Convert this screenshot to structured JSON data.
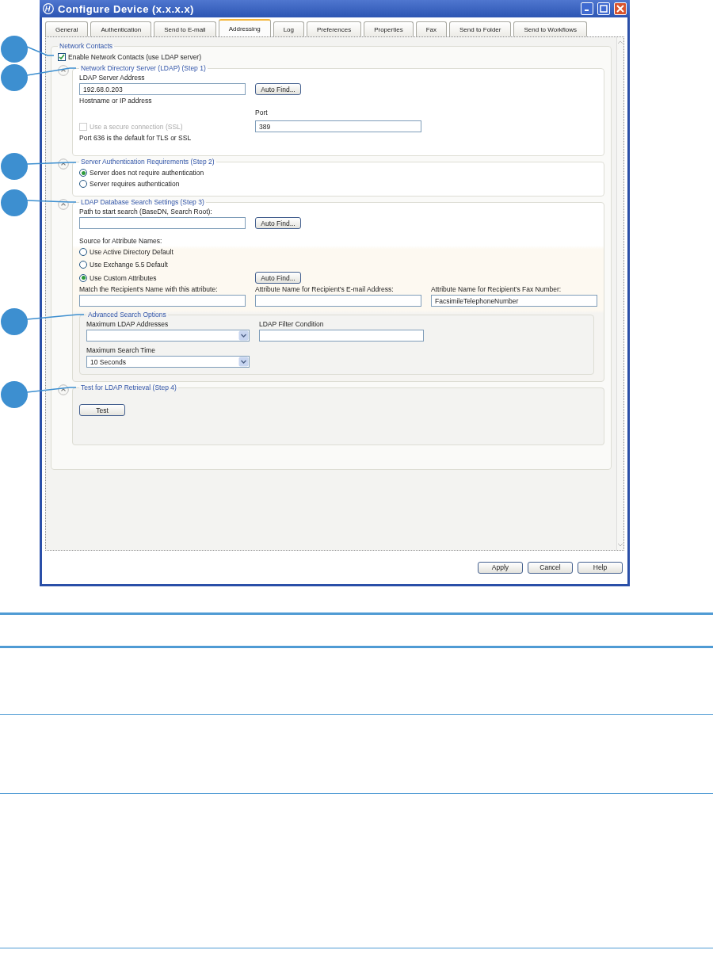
{
  "window": {
    "title": "Configure Device (x.x.x.x)",
    "buttons": [
      "Apply",
      "Cancel",
      "Help"
    ]
  },
  "tabs": [
    {
      "label": "General",
      "selected": false
    },
    {
      "label": "Authentication",
      "selected": false
    },
    {
      "label": "Send to E-mail",
      "selected": false
    },
    {
      "label": "Addressing",
      "selected": true
    },
    {
      "label": "Log",
      "selected": false
    },
    {
      "label": "Preferences",
      "selected": false
    },
    {
      "label": "Properties",
      "selected": false
    },
    {
      "label": "Fax",
      "selected": false
    },
    {
      "label": "Send to Folder",
      "selected": false
    },
    {
      "label": "Send to Workflows",
      "selected": false
    }
  ],
  "network_contacts": {
    "title": "Network Contacts",
    "enable_checkbox": {
      "label": "Enable Network Contacts (use LDAP server)",
      "checked": true,
      "disabled": false
    }
  },
  "step1": {
    "title": "Network Directory Server (LDAP) (Step 1)",
    "address_label": "LDAP Server Address",
    "address_value": "192.68.0.203",
    "auto_find": "Auto Find...",
    "address_hint": "Hostname or IP address",
    "ssl_checkbox": {
      "label": "Use a secure connection (SSL)",
      "checked": false,
      "disabled": true
    },
    "port_label": "Port",
    "port_value": "389",
    "port_note": "Port 636 is the default for TLS or SSL"
  },
  "step2": {
    "title": "Server Authentication Requirements (Step 2)",
    "options": [
      {
        "label": "Server does not require authentication",
        "selected": true
      },
      {
        "label": "Server requires authentication",
        "selected": false
      }
    ]
  },
  "step3": {
    "title": "LDAP Database Search Settings (Step 3)",
    "path_label": "Path to start search (BaseDN, Search Root):",
    "auto_find": "Auto Find...",
    "source_label": "Source for Attribute Names:",
    "sources": [
      {
        "label": "Use Active Directory Default",
        "selected": false
      },
      {
        "label": "Use Exchange 5.5 Default",
        "selected": false
      },
      {
        "label": "Use Custom Attributes",
        "selected": true
      }
    ],
    "custom_auto_find": "Auto Find...",
    "attributes": [
      {
        "label": "Match the Recipient's Name with this attribute:"
      },
      {
        "label": "Attribute Name for Recipient's E-mail Address:"
      },
      {
        "label": "Attribute Name for Recipient's Fax Number:",
        "value": "FacsimileTelephoneNumber"
      }
    ],
    "advanced": {
      "title": "Advanced Search Options",
      "max_addresses_label": "Maximum LDAP Addresses",
      "filter_label": "LDAP Filter Condition",
      "max_time_label": "Maximum Search Time",
      "max_time_value": "10 Seconds"
    }
  },
  "step4": {
    "title": "Test for LDAP Retrieval (Step 4)",
    "test_button": "Test"
  }
}
